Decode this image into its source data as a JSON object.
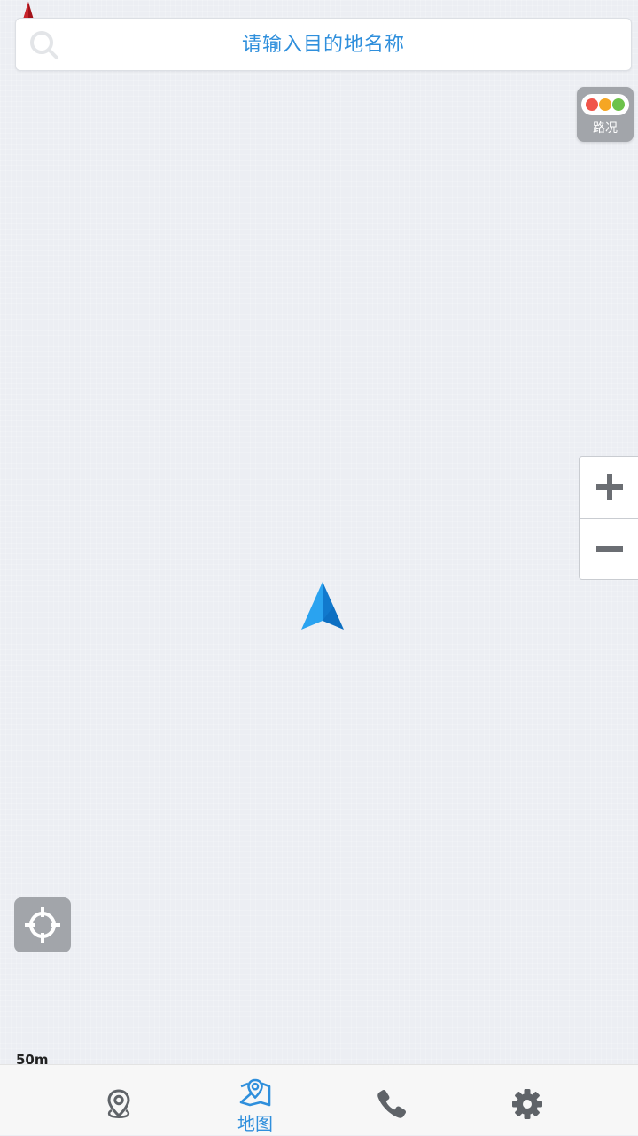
{
  "search": {
    "placeholder": "请输入目的地名称"
  },
  "traffic": {
    "label": "路况",
    "light_colors": [
      "#f0554a",
      "#f5a623",
      "#6cc24a"
    ]
  },
  "map": {
    "scale_label": "50m",
    "background_color": "#eceef3",
    "arrow_color": "#1e8fe8"
  },
  "zoom": {
    "zoom_in_icon": "plus-icon",
    "zoom_out_icon": "minus-icon"
  },
  "bottom_nav": {
    "active_index": 1,
    "active_color": "#2f8fdc",
    "inactive_color": "#5f6368",
    "items": [
      {
        "icon": "location-pin-icon",
        "label": ""
      },
      {
        "icon": "map-icon",
        "label": "地图"
      },
      {
        "icon": "phone-icon",
        "label": ""
      },
      {
        "icon": "gear-icon",
        "label": ""
      }
    ]
  }
}
